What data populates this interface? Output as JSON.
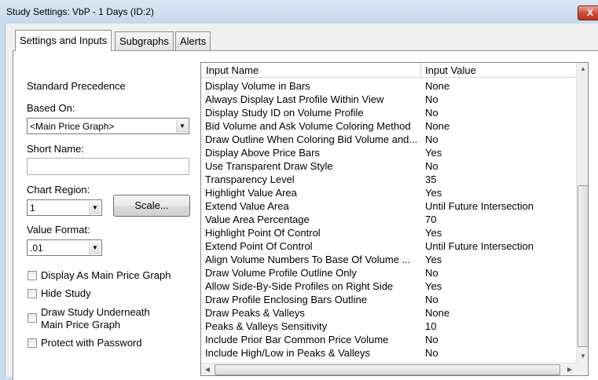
{
  "window": {
    "title": "Study Settings: VbP - 1 Days (ID:2)",
    "close_label": "X"
  },
  "tabs": [
    {
      "label": "Settings and Inputs",
      "active": true
    },
    {
      "label": "Subgraphs",
      "active": false
    },
    {
      "label": "Alerts",
      "active": false
    }
  ],
  "left": {
    "standard_precedence": "Standard Precedence",
    "based_on_label": "Based On:",
    "based_on_value": "<Main Price Graph>",
    "short_name_label": "Short Name:",
    "short_name_value": "",
    "chart_region_label": "Chart Region:",
    "chart_region_value": "1",
    "scale_button": "Scale...",
    "value_format_label": "Value Format:",
    "value_format_value": ".01",
    "checkboxes": [
      {
        "label": "Display As Main Price Graph",
        "checked": false
      },
      {
        "label": "Hide Study",
        "checked": false
      },
      {
        "label": "Draw Study Underneath",
        "label2": "Main Price Graph",
        "checked": false
      },
      {
        "label": "Protect with Password",
        "checked": false
      }
    ]
  },
  "grid": {
    "col_name": "Input Name",
    "col_value": "Input Value",
    "rows": [
      {
        "name": "Display Volume in Bars",
        "value": "None"
      },
      {
        "name": "Always Display Last Profile Within View",
        "value": "No"
      },
      {
        "name": "Display Study ID on Volume Profile",
        "value": "No"
      },
      {
        "name": "Bid Volume and Ask Volume Coloring Method",
        "value": "None"
      },
      {
        "name": "Draw Outline When Coloring Bid Volume and...",
        "value": "No"
      },
      {
        "name": "Display Above Price Bars",
        "value": "Yes"
      },
      {
        "name": "Use Transparent Draw Style",
        "value": "No"
      },
      {
        "name": "Transparency Level",
        "value": "35"
      },
      {
        "name": "Highlight Value Area",
        "value": "Yes"
      },
      {
        "name": "Extend Value Area",
        "value": "Until Future Intersection"
      },
      {
        "name": "Value Area Percentage",
        "value": "70"
      },
      {
        "name": "Highlight Point Of Control",
        "value": "Yes"
      },
      {
        "name": "Extend Point Of Control",
        "value": "Until Future Intersection"
      },
      {
        "name": "Align Volume Numbers To Base Of Volume ...",
        "value": "Yes"
      },
      {
        "name": "Draw Volume Profile Outline Only",
        "value": "No"
      },
      {
        "name": "Allow Side-By-Side Profiles on Right Side",
        "value": "Yes"
      },
      {
        "name": "Draw Profile Enclosing Bars Outline",
        "value": "No"
      },
      {
        "name": "Draw Peaks & Valleys",
        "value": "None"
      },
      {
        "name": "Peaks & Valleys Sensitivity",
        "value": "10"
      },
      {
        "name": "Include Prior Bar Common Price Volume",
        "value": "No"
      },
      {
        "name": "Include High/Low in Peaks & Valleys",
        "value": "No"
      }
    ]
  }
}
